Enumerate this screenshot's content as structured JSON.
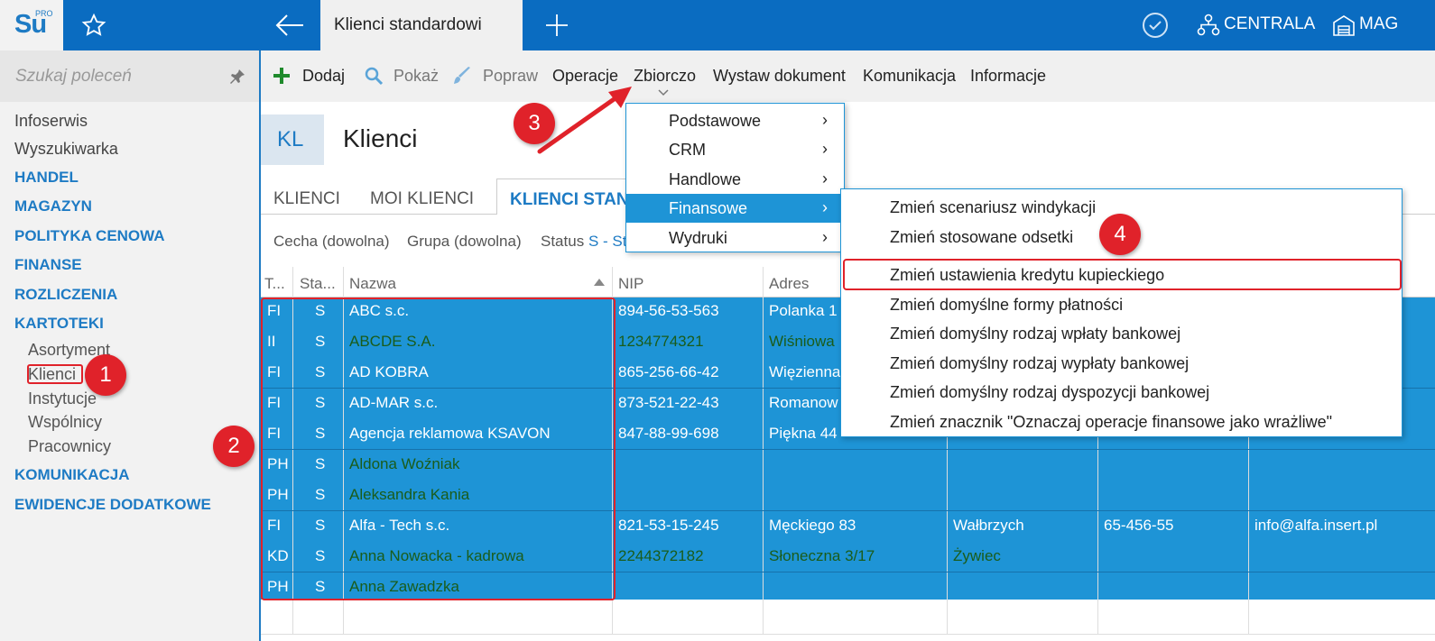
{
  "app": {
    "logo": "Su",
    "logo_sup": "PRO",
    "tab_title": "Klienci standardowi",
    "centrala": "CENTRALA",
    "mag": "MAG"
  },
  "sidebar": {
    "search_placeholder": "Szukaj poleceń",
    "items": [
      "Infoserwis",
      "Wyszukiwarka"
    ],
    "sections": [
      "HANDEL",
      "MAGAZYN",
      "POLITYKA CENOWA",
      "FINANSE",
      "ROZLICZENIA",
      "KARTOTEKI"
    ],
    "kartoteki_sub": [
      "Asortyment",
      "Klienci",
      "Instytucje",
      "Wspólnicy",
      "Pracownicy"
    ],
    "sections2": [
      "KOMUNIKACJA",
      "EWIDENCJE DODATKOWE"
    ]
  },
  "toolbar": {
    "add": "Dodaj",
    "show": "Pokaż",
    "edit": "Popraw",
    "ops": "Operacje",
    "bulk": "Zbiorczo",
    "issue": "Wystaw dokument",
    "comm": "Komunikacja",
    "info": "Informacje"
  },
  "header": {
    "code": "KL",
    "title": "Klienci"
  },
  "view_tabs": [
    "KLIENCI",
    "MOI KLIENCI",
    "KLIENCI STAN"
  ],
  "filters": {
    "feature": "Cecha (dowolna)",
    "group": "Grupa (dowolna)",
    "status_label": "Status",
    "status_value": "S - St"
  },
  "grid": {
    "columns": [
      "T...",
      "Sta...",
      "Nazwa",
      "NIP",
      "Adres"
    ],
    "rows": [
      {
        "type": "FI",
        "status": "S",
        "name": "ABC s.c.",
        "nip": "894-56-53-563",
        "address": "Polanka  1",
        "city": "",
        "postal": "",
        "email": "",
        "color": "w"
      },
      {
        "type": "II",
        "status": "S",
        "name": "ABCDE S.A.",
        "nip": "1234774321",
        "address": "Wiśniowa",
        "city": "",
        "postal": "",
        "email": "",
        "color": "g"
      },
      {
        "type": "FI",
        "status": "S",
        "name": "AD KOBRA",
        "nip": "865-256-66-42",
        "address": "Więzienna",
        "city": "",
        "postal": "",
        "email": "",
        "color": "w"
      },
      {
        "type": "FI",
        "status": "S",
        "name": "AD-MAR s.c.",
        "nip": "873-521-22-43",
        "address": "Romanow",
        "city": "",
        "postal": "",
        "email": "",
        "color": "w"
      },
      {
        "type": "FI",
        "status": "S",
        "name": "Agencja reklamowa KSAVON",
        "nip": "847-88-99-698",
        "address": "Piękna  44",
        "city": "",
        "postal": "",
        "email": "",
        "color": "w"
      },
      {
        "type": "PH",
        "status": "S",
        "name": "Aldona Woźniak",
        "nip": "",
        "address": "",
        "city": "",
        "postal": "",
        "email": "",
        "color": "g"
      },
      {
        "type": "PH",
        "status": "S",
        "name": "Aleksandra Kania",
        "nip": "",
        "address": "",
        "city": "",
        "postal": "",
        "email": "",
        "color": "g"
      },
      {
        "type": "FI",
        "status": "S",
        "name": "Alfa - Tech s.c.",
        "nip": "821-53-15-245",
        "address": "Męckiego  83",
        "city": "Wałbrzych",
        "postal": "65-456-55",
        "email": "info@alfa.insert.pl",
        "color": "w"
      },
      {
        "type": "KD",
        "status": "S",
        "name": "Anna Nowacka - kadrowa",
        "nip": "2244372182",
        "address": "Słoneczna 3/17",
        "city": "Żywiec",
        "postal": "",
        "email": "",
        "color": "g"
      },
      {
        "type": "PH",
        "status": "S",
        "name": "Anna Zawadzka",
        "nip": "",
        "address": "",
        "city": "",
        "postal": "",
        "email": "",
        "color": "g"
      }
    ]
  },
  "menu1": [
    "Podstawowe",
    "CRM",
    "Handlowe",
    "Finansowe",
    "Wydruki"
  ],
  "menu1_arrow": "›",
  "menu2": [
    "Zmień scenariusz windykacji",
    "Zmień stosowane odsetki",
    "Zmień ustawienia kredytu kupieckiego",
    "Zmień domyślne formy płatności",
    "Zmień domyślny rodzaj wpłaty bankowej",
    "Zmień domyślny rodzaj wypłaty bankowej",
    "Zmień domyślny rodzaj dyspozycji bankowej",
    "Zmień znacznik \"Oznaczaj operacje finansowe jako wrażliwe\""
  ],
  "badges": [
    "1",
    "2",
    "3",
    "4"
  ],
  "colors": {
    "accent": "#0a6cc1",
    "selection": "#1e94d6",
    "highlight": "#e0222a"
  }
}
